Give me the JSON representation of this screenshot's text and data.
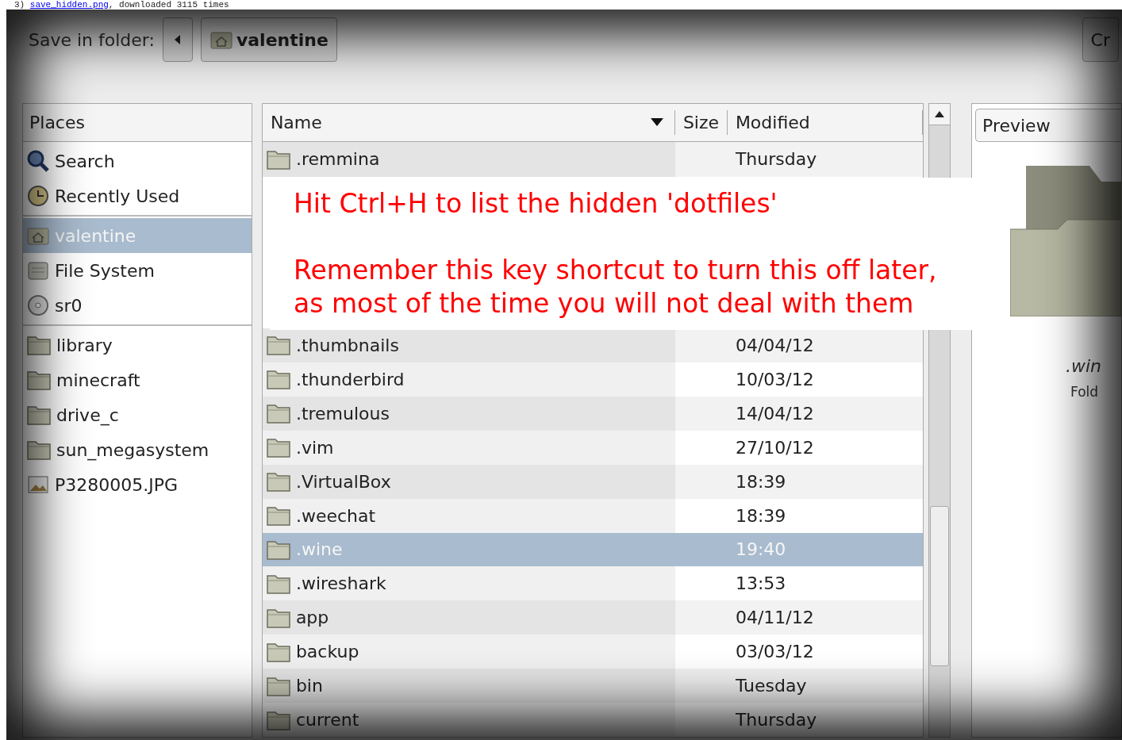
{
  "caption": {
    "number": "3)",
    "link": "save_hidden.png",
    "rest": ", downloaded 3115 times"
  },
  "toolbar": {
    "label": "Save in folder:",
    "path_button": "valentine",
    "create_button": "Cr"
  },
  "places": {
    "header": "Places",
    "groups": [
      [
        {
          "label": "Search",
          "kind": "search",
          "selected": false
        },
        {
          "label": "Recently Used",
          "kind": "recent",
          "selected": false
        }
      ],
      [
        {
          "label": "valentine",
          "kind": "home",
          "selected": true
        },
        {
          "label": "File System",
          "kind": "filesystem",
          "selected": false
        },
        {
          "label": "sr0",
          "kind": "optical",
          "selected": false
        }
      ],
      [
        {
          "label": "library",
          "kind": "bookmark",
          "selected": false
        },
        {
          "label": "minecraft",
          "kind": "bookmark",
          "selected": false
        },
        {
          "label": "drive_c",
          "kind": "bookmark",
          "selected": false
        },
        {
          "label": "sun_megasystem",
          "kind": "bookmark",
          "selected": false
        },
        {
          "label": "P3280005.JPG",
          "kind": "file",
          "selected": false
        }
      ]
    ]
  },
  "file_list": {
    "columns": [
      "Name",
      "Size",
      "Modified"
    ],
    "rows_above": [
      {
        "name": ".remmina",
        "modified": "Thursday",
        "selected": false
      }
    ],
    "rows": [
      {
        "name": ".thumbnails",
        "modified": "04/04/12",
        "selected": false
      },
      {
        "name": ".thunderbird",
        "modified": "10/03/12",
        "selected": false
      },
      {
        "name": ".tremulous",
        "modified": "14/04/12",
        "selected": false
      },
      {
        "name": ".vim",
        "modified": "27/10/12",
        "selected": false
      },
      {
        "name": ".VirtualBox",
        "modified": "18:39",
        "selected": false
      },
      {
        "name": ".weechat",
        "modified": "18:39",
        "selected": false
      },
      {
        "name": ".wine",
        "modified": "19:40",
        "selected": true
      },
      {
        "name": ".wireshark",
        "modified": "13:53",
        "selected": false
      },
      {
        "name": "app",
        "modified": "04/11/12",
        "selected": false
      },
      {
        "name": "backup",
        "modified": "03/03/12",
        "selected": false
      },
      {
        "name": "bin",
        "modified": "Tuesday",
        "selected": false
      },
      {
        "name": "current",
        "modified": "Thursday",
        "selected": false
      }
    ]
  },
  "note": {
    "paragraphs": [
      [
        "Hit Ctrl+H to list the hidden 'dotfiles'"
      ],
      [
        "Remember this key shortcut to turn this off later,",
        "as most of the time you will not deal with them"
      ]
    ]
  },
  "preview": {
    "label": "Preview",
    "name": ".win",
    "type": "Fold"
  }
}
